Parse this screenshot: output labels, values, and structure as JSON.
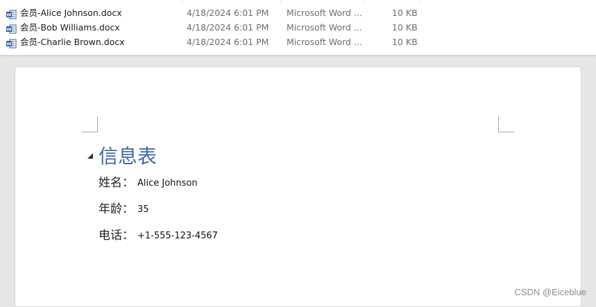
{
  "explorer": {
    "files": [
      {
        "name": "会员-Alice Johnson.docx",
        "date": "4/18/2024 6:01 PM",
        "type": "Microsoft Word ...",
        "size": "10 KB",
        "icon": "word-doc-icon"
      },
      {
        "name": "会员-Bob Williams.docx",
        "date": "4/18/2024 6:01 PM",
        "type": "Microsoft Word ...",
        "size": "10 KB",
        "icon": "word-doc-icon"
      },
      {
        "name": "会员-Charlie Brown.docx",
        "date": "4/18/2024 6:01 PM",
        "type": "Microsoft Word ...",
        "size": "10 KB",
        "icon": "word-doc-icon"
      }
    ]
  },
  "document": {
    "heading": "信息表",
    "fields": [
      {
        "label": "姓名：",
        "value": "Alice Johnson"
      },
      {
        "label": "年龄：",
        "value": "35"
      },
      {
        "label": "电话：",
        "value": "+1-555-123-4567"
      }
    ],
    "heading_color": "#3f68a8"
  },
  "watermark": "CSDN @Eiceblue"
}
